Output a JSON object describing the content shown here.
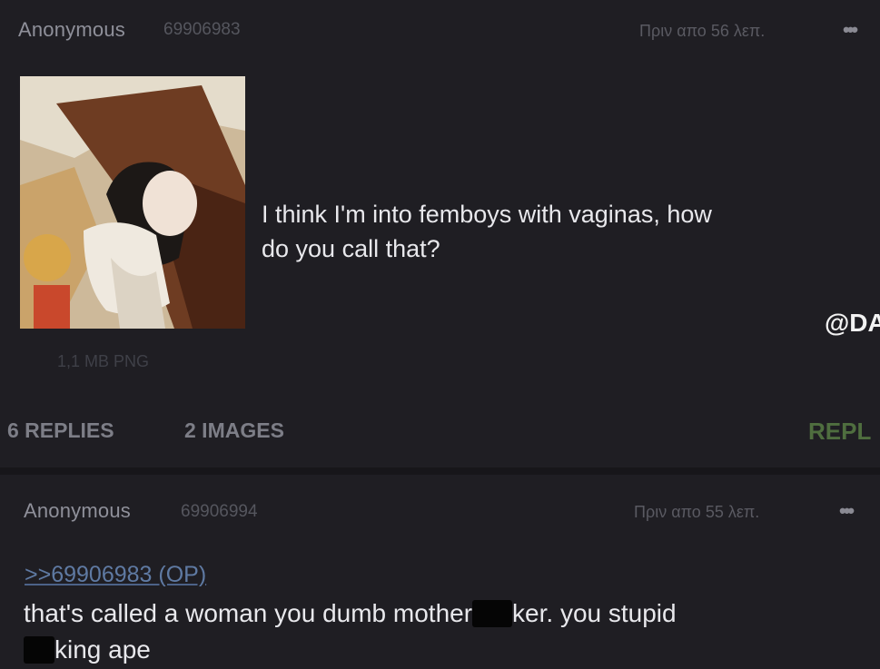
{
  "post1": {
    "name": "Anonymous",
    "id": "69906983",
    "time": "Πριν απο 56 λεπ.",
    "text_line1": "I think I'm into femboys with vaginas, how",
    "text_line2": "do you call that?",
    "file_info": "1,1 MB PNG",
    "replies": "6 REPLIES",
    "images": "2 IMAGES",
    "reply_button": "REPL",
    "more_icon": "•••"
  },
  "watermark": "@DA",
  "post2": {
    "name": "Anonymous",
    "id": "69906994",
    "time": "Πριν απο 55 λεπ.",
    "quote": ">>69906983 (OP)",
    "line1_part1": "that's called a woman you dumb mother",
    "line1_part2": "ker. you stupid",
    "line2_part2": "king ape",
    "more_icon": "•••"
  },
  "colors": {
    "background": "#1f1e23",
    "name": "#8f909a",
    "quote_link": "#5f7aa3",
    "reply_button": "#4f6e3f"
  }
}
